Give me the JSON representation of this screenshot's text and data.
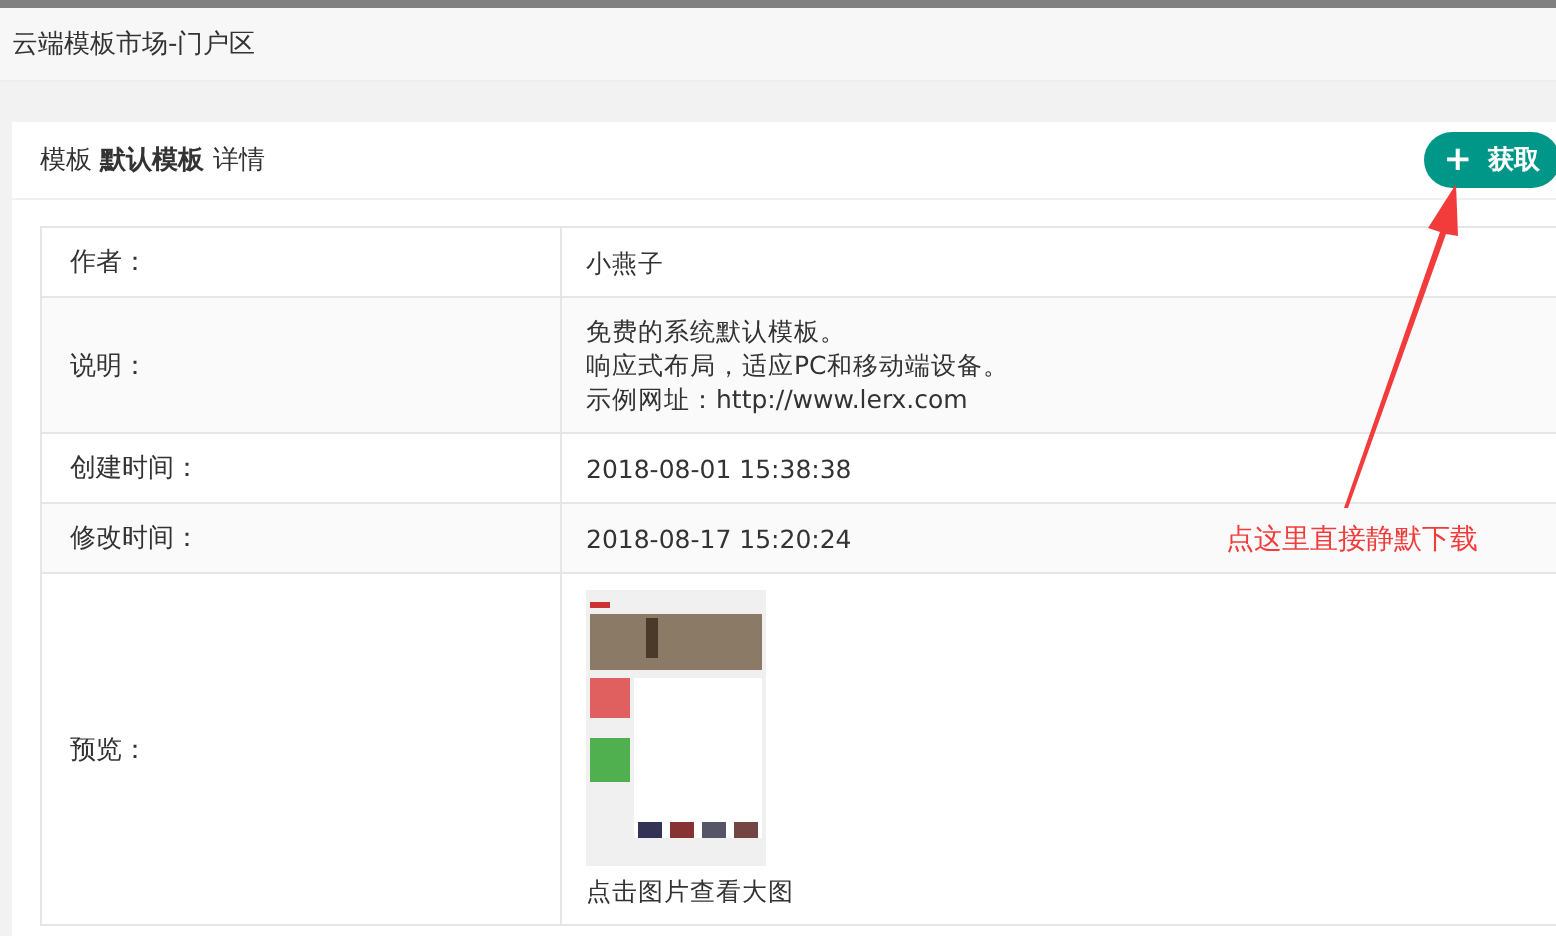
{
  "header": {
    "title": "云端模板市场-门户区"
  },
  "card": {
    "title": "模板 **默认模板** 详情",
    "get_button": {
      "icon": "+",
      "label": "获取"
    }
  },
  "table": {
    "rows": [
      {
        "kind": "text",
        "label": "作者：",
        "value": "小燕子"
      },
      {
        "kind": "lines",
        "label": "说明：",
        "lines": [
          "免费的系统默认模板。",
          "响应式布局，适应PC和移动端设备。",
          "示例网址：http://www.lerx.com"
        ]
      },
      {
        "kind": "text",
        "label": "创建时间：",
        "value": "2018-08-01 15:38:38"
      },
      {
        "kind": "text",
        "label": "修改时间：",
        "value": "2018-08-17 15:20:24"
      },
      {
        "kind": "image",
        "label": "预览：",
        "caption": "点击图片查看大图"
      }
    ]
  },
  "annotation": {
    "text": "点这里直接静默下载"
  }
}
